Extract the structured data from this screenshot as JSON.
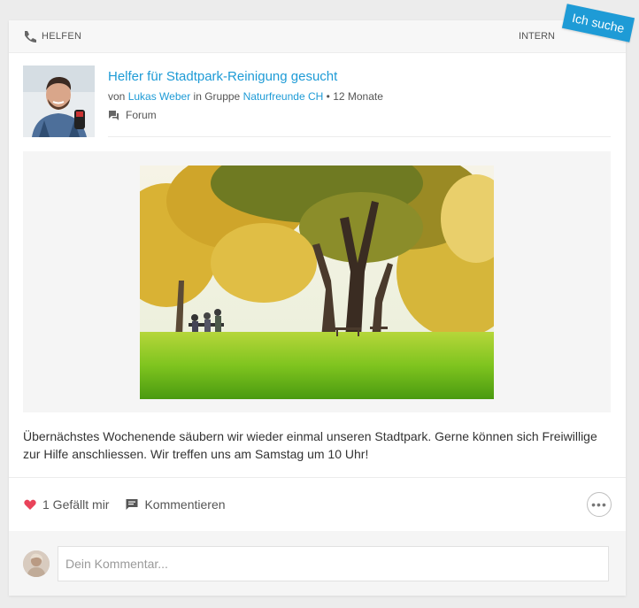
{
  "header": {
    "category_icon": "helping-hand-icon",
    "category_label": "HELFEN",
    "visibility_label": "INTERN",
    "ribbon_label": "Ich suche",
    "ribbon_color": "#1e9bd6"
  },
  "post": {
    "title": "Helfer für Stadtpark-Reinigung gesucht",
    "by_prefix": "von",
    "author": "Lukas Weber",
    "in_group_prefix": "in Gruppe",
    "group": "Naturfreunde CH",
    "time": "12 Monate",
    "channel_icon": "forum-icon",
    "channel": "Forum",
    "body": "Übernächstes Wochenende säubern wir wieder einmal unseren Stadtpark. Gerne können sich Freiwillige zur Hilfe anschliessen. Wir treffen uns am Samstag um 10 Uhr!",
    "link_color": "#1e9bd6"
  },
  "actions": {
    "like_icon": "heart-icon",
    "like_label": "1 Gefällt mir",
    "comment_icon": "comment-icon",
    "comment_label": "Kommentieren",
    "more_icon": "more-icon",
    "like_color": "#e9435a"
  },
  "comment_box": {
    "placeholder": "Dein Kommentar..."
  }
}
